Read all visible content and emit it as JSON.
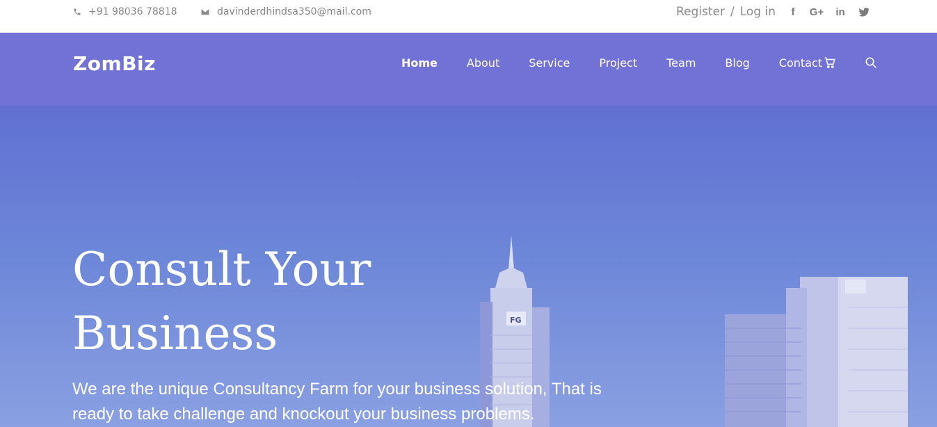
{
  "topbar": {
    "phone": "+91 98036 78818",
    "email": "davinderdhindsa350@mail.com",
    "register": "Register",
    "separator": "/",
    "login": "Log in",
    "social": [
      {
        "icon": "facebook-icon",
        "glyph": "f"
      },
      {
        "icon": "google-plus-icon",
        "glyph": "G+"
      },
      {
        "icon": "linkedin-icon",
        "glyph": "in"
      },
      {
        "icon": "twitter-icon",
        "glyph": "t"
      }
    ]
  },
  "navbar": {
    "logo": "ZomBiz",
    "items": [
      "Home",
      "About",
      "Service",
      "Project",
      "Team",
      "Blog",
      "Contact"
    ],
    "active": "Home",
    "cart_icon": "cart-icon",
    "search_icon": "search-icon"
  },
  "hero": {
    "title_line1": "Consult Your",
    "title_line2": "Business",
    "subtitle": "We are the unique Consultancy Farm for your business solution, That is ready to take challenge and knockout your business problems."
  },
  "colors": {
    "nav_bg": "#7272d6",
    "hero_overlay": "#6c86d8",
    "text_light": "#ffffff",
    "topbar_text": "#858585"
  }
}
